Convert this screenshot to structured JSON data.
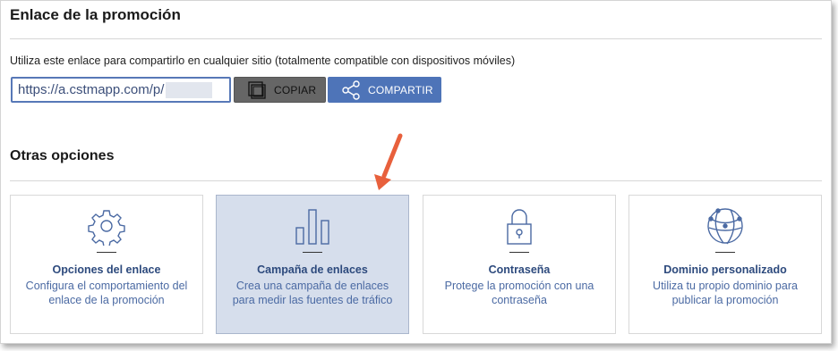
{
  "link_section": {
    "heading": "Enlace de la promoción",
    "description": "Utiliza este enlace para compartirlo en cualquier sitio (totalmente compatible con dispositivos móviles)",
    "url_value": "https://a.cstmapp.com/p/",
    "copy_label": "COPIAR",
    "share_label": "COMPARTIR"
  },
  "options_section": {
    "heading": "Otras opciones",
    "cards": [
      {
        "title": "Opciones del enlace",
        "text": "Configura el comportamiento del enlace de la promoción",
        "icon": "gear-icon"
      },
      {
        "title": "Campaña de enlaces",
        "text": "Crea una campaña de enlaces para medir las fuentes de tráfico",
        "icon": "bar-chart-icon",
        "highlighted": true
      },
      {
        "title": "Contraseña",
        "text": "Protege la promoción con una contraseña",
        "icon": "lock-icon"
      },
      {
        "title": "Dominio personalizado",
        "text": "Utiliza tu propio dominio para publicar la promoción",
        "icon": "globe-icon"
      }
    ]
  },
  "colors": {
    "accent": "#4e74b8",
    "card_highlight": "#d6deec",
    "arrow": "#e8603c"
  }
}
